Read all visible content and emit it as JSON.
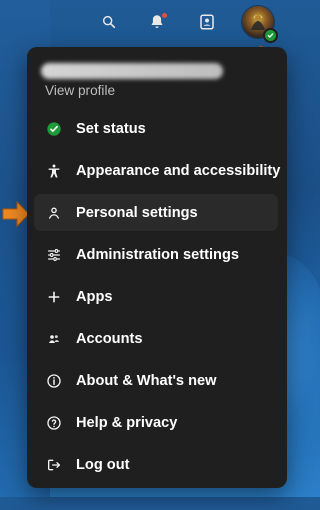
{
  "header": {
    "icons": [
      "search-icon",
      "bell-icon",
      "contact-card-icon"
    ],
    "notification_color": "#e74c3c"
  },
  "profile": {
    "status_color": "#1f9b3a",
    "view_profile_label": "View profile"
  },
  "menu": {
    "items": [
      {
        "label": "Set status",
        "icon": "check-circle-icon"
      },
      {
        "label": "Appearance and accessibility",
        "icon": "accessibility-icon"
      },
      {
        "label": "Personal settings",
        "icon": "person-icon"
      },
      {
        "label": "Administration settings",
        "icon": "sliders-icon"
      },
      {
        "label": "Apps",
        "icon": "plus-icon"
      },
      {
        "label": "Accounts",
        "icon": "people-icon"
      },
      {
        "label": "About & What's new",
        "icon": "info-icon"
      },
      {
        "label": "Help & privacy",
        "icon": "help-icon"
      },
      {
        "label": "Log out",
        "icon": "logout-icon"
      }
    ]
  },
  "colors": {
    "menu_bg": "#1f1f1f",
    "menu_hover_bg": "#2a2a2a",
    "text": "#ffffff",
    "muted_text": "#bdbdbd",
    "annotation_orange": "#f08a24"
  }
}
